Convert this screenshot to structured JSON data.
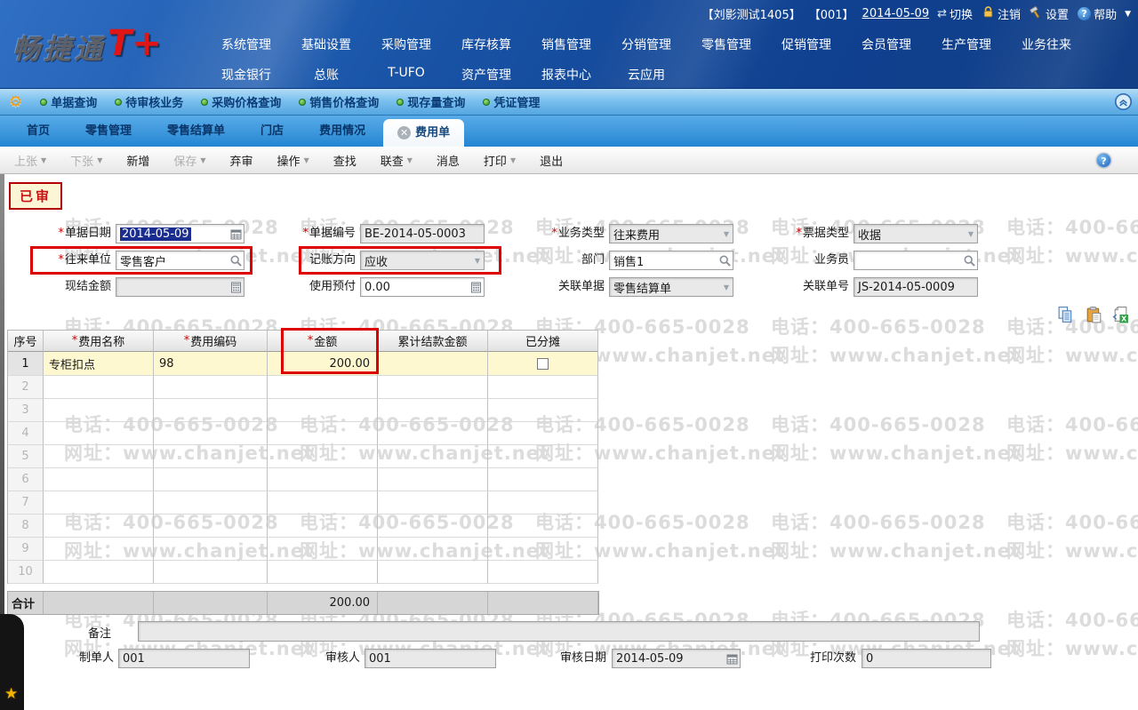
{
  "brand": {
    "name_cn": "畅捷通",
    "name_plus": "T+"
  },
  "statusbar": {
    "user": "【刘影测试1405】",
    "account": "【001】",
    "date": "2014-05-09",
    "actions": [
      {
        "label": "切换",
        "icon": "switch-icon"
      },
      {
        "label": "注销",
        "icon": "lock-icon"
      },
      {
        "label": "设置",
        "icon": "tools-icon"
      },
      {
        "label": "帮助",
        "icon": "help-icon"
      }
    ]
  },
  "menu": {
    "row1": [
      "系统管理",
      "基础设置",
      "采购管理",
      "库存核算",
      "销售管理",
      "分销管理",
      "零售管理",
      "促销管理",
      "会员管理",
      "生产管理",
      "业务往来"
    ],
    "row2": [
      "现金银行",
      "总账",
      "T-UFO",
      "资产管理",
      "报表中心",
      "云应用"
    ]
  },
  "quickbar": {
    "items": [
      "单据查询",
      "待审核业务",
      "采购价格查询",
      "销售价格查询",
      "现存量查询",
      "凭证管理"
    ]
  },
  "tabs": [
    {
      "label": "首页"
    },
    {
      "label": "零售管理"
    },
    {
      "label": "零售结算单"
    },
    {
      "label": "门店"
    },
    {
      "label": "费用情况"
    },
    {
      "label": "费用单",
      "active": true,
      "closable": true
    }
  ],
  "toolbar": [
    {
      "label": "上张",
      "caret": true,
      "disabled": true
    },
    {
      "label": "下张",
      "caret": true,
      "disabled": true
    },
    {
      "label": "新增"
    },
    {
      "label": "保存",
      "caret": true,
      "disabled": true
    },
    {
      "label": "弃审"
    },
    {
      "label": "操作",
      "caret": true
    },
    {
      "label": "查找"
    },
    {
      "label": "联查",
      "caret": true
    },
    {
      "label": "消息"
    },
    {
      "label": "打印",
      "caret": true
    },
    {
      "label": "退出"
    }
  ],
  "stamp": "已审",
  "form": {
    "fields": [
      {
        "id": "bill-date",
        "label": "单据日期",
        "required": true,
        "value": "2014-05-09",
        "icon": "calendar",
        "selected": true,
        "disabled": false,
        "col": 0,
        "row": 0
      },
      {
        "id": "partner",
        "label": "往来单位",
        "required": true,
        "value": "零售客户",
        "icon": "magnifier",
        "selected": false,
        "disabled": false,
        "col": 0,
        "row": 1
      },
      {
        "id": "cash-amount",
        "label": "现结金额",
        "required": false,
        "value": "",
        "icon": "calculator",
        "selected": false,
        "disabled": true,
        "col": 0,
        "row": 2
      },
      {
        "id": "bill-no",
        "label": "单据编号",
        "required": true,
        "value": "BE-2014-05-0003",
        "icon": null,
        "selected": false,
        "disabled": true,
        "col": 1,
        "row": 0
      },
      {
        "id": "book-dir",
        "label": "记账方向",
        "required": false,
        "value": "应收",
        "icon": "dropdown",
        "selected": false,
        "disabled": true,
        "col": 1,
        "row": 1
      },
      {
        "id": "use-prepay",
        "label": "使用预付",
        "required": false,
        "value": "0.00",
        "icon": "calculator",
        "selected": false,
        "disabled": false,
        "col": 1,
        "row": 2
      },
      {
        "id": "biz-type",
        "label": "业务类型",
        "required": true,
        "value": "往来费用",
        "icon": "dropdown",
        "selected": false,
        "disabled": true,
        "col": 2,
        "row": 0
      },
      {
        "id": "department",
        "label": "部门",
        "required": false,
        "value": "销售1",
        "icon": "magnifier",
        "selected": false,
        "disabled": false,
        "col": 2,
        "row": 1
      },
      {
        "id": "rel-doc",
        "label": "关联单据",
        "required": false,
        "value": "零售结算单",
        "icon": "dropdown",
        "selected": false,
        "disabled": true,
        "col": 2,
        "row": 2
      },
      {
        "id": "ticket-type",
        "label": "票据类型",
        "required": true,
        "value": "收据",
        "icon": "dropdown",
        "selected": false,
        "disabled": true,
        "col": 3,
        "row": 0
      },
      {
        "id": "salesman",
        "label": "业务员",
        "required": false,
        "value": "",
        "icon": "magnifier",
        "selected": false,
        "disabled": false,
        "col": 3,
        "row": 1
      },
      {
        "id": "rel-no",
        "label": "关联单号",
        "required": false,
        "value": "JS-2014-05-0009",
        "icon": null,
        "selected": false,
        "disabled": true,
        "col": 3,
        "row": 2
      }
    ]
  },
  "grid": {
    "icons": [
      "copy-icon",
      "paste-icon",
      "excel-export-icon"
    ],
    "columns": [
      {
        "label": "序号",
        "required": false
      },
      {
        "label": "费用名称",
        "required": true
      },
      {
        "label": "费用编码",
        "required": true
      },
      {
        "label": "金额",
        "required": true
      },
      {
        "label": "累计结款金额",
        "required": false
      },
      {
        "label": "已分摊",
        "required": false
      }
    ],
    "rows": [
      {
        "seq": "1",
        "fee_name": "专柜扣点",
        "fee_code": "98",
        "amount": "200.00",
        "settled": "",
        "allocated": false
      }
    ],
    "empty_row_count": 9,
    "total": {
      "label": "合计",
      "amount": "200.00"
    }
  },
  "footer": {
    "remark_label": "备注",
    "remark_value": "",
    "maker_label": "制单人",
    "maker": "001",
    "auditor_label": "审核人",
    "auditor": "001",
    "audit_date_label": "审核日期",
    "audit_date": "2014-05-09",
    "print_count_label": "打印次数",
    "print_count": "0"
  },
  "watermark": {
    "phone": "电话：400-665-0028",
    "site": "网址：www.chanjet.net"
  },
  "colors": {
    "highlight_red": "#dd0000",
    "banner_blue": "#15489c",
    "tabstrip_blue": "#3d97dc",
    "row_highlight": "#fdf8cf",
    "selection_navy": "#1b2d8e"
  }
}
